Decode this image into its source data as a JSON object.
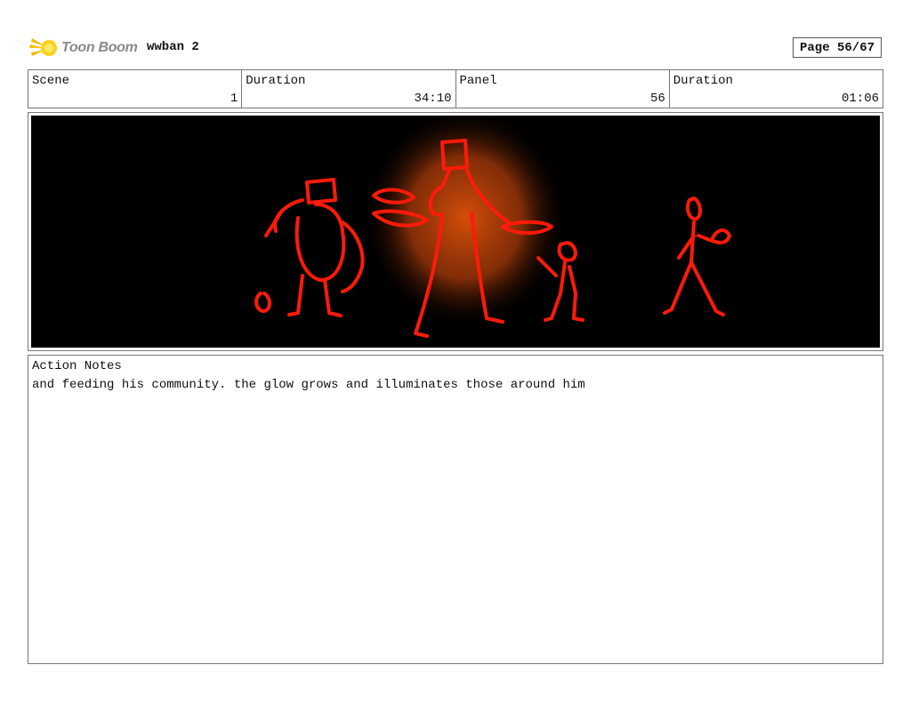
{
  "header": {
    "brand": "Toon Boom",
    "project": "wwban 2",
    "page": "Page 56/67"
  },
  "info": {
    "scene_label": "Scene",
    "scene_value": "1",
    "duration1_label": "Duration",
    "duration1_value": "34:10",
    "panel_label": "Panel",
    "panel_value": "56",
    "duration2_label": "Duration",
    "duration2_value": "01:06"
  },
  "panel_image": {
    "background": "#000000",
    "stroke_color": "#ff1a0a",
    "glow_color": "#e0520a"
  },
  "notes": {
    "title": "Action Notes",
    "text": "and feeding his community. the glow grows and illuminates those around him"
  }
}
